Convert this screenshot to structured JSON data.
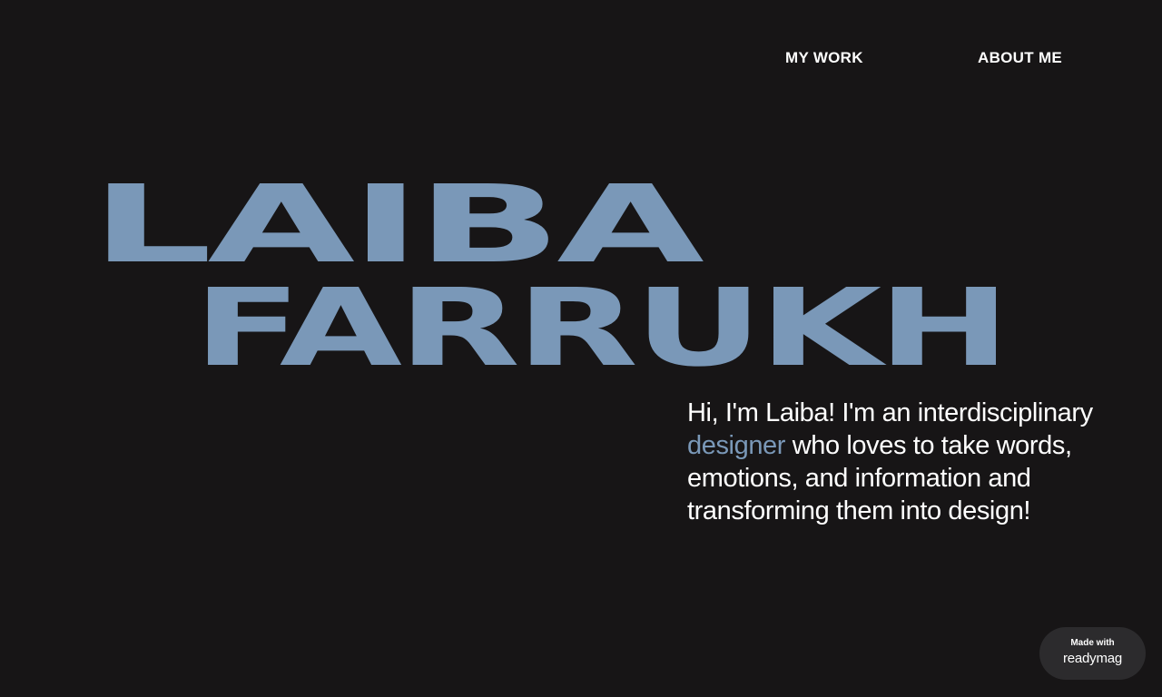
{
  "nav": {
    "items": [
      {
        "label": "MY WORK"
      },
      {
        "label": "ABOUT ME"
      }
    ]
  },
  "hero": {
    "first_name": "LAIBA",
    "last_name": "FARRUKH",
    "color": "#7a98b8"
  },
  "intro": {
    "part1": "Hi, I'm Laiba! I'm an interdisciplinary ",
    "highlight": "designer",
    "part2": " who loves to take words, emotions, and information and transforming them into design!"
  },
  "badge": {
    "top": "Made with",
    "brand": "readymag"
  },
  "colors": {
    "background": "#171516",
    "accent": "#7a98b8",
    "text": "#ffffff",
    "badge_bg": "#2c2b2d"
  }
}
